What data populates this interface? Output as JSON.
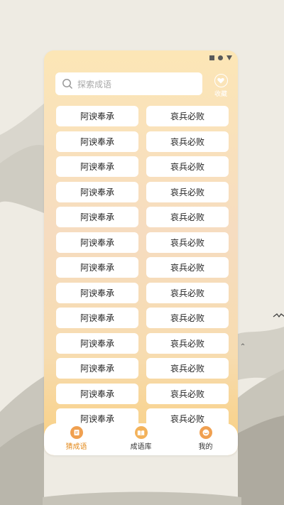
{
  "search": {
    "placeholder": "探索成语",
    "icon": "search-icon"
  },
  "favorite": {
    "label": "收藏",
    "icon": "heart-icon"
  },
  "idiom_rows": [
    {
      "left": "阿谀奉承",
      "right": "哀兵必败"
    },
    {
      "left": "阿谀奉承",
      "right": "哀兵必败"
    },
    {
      "left": "阿谀奉承",
      "right": "哀兵必败"
    },
    {
      "left": "阿谀奉承",
      "right": "哀兵必败"
    },
    {
      "left": "阿谀奉承",
      "right": "哀兵必败"
    },
    {
      "left": "阿谀奉承",
      "right": "哀兵必败"
    },
    {
      "left": "阿谀奉承",
      "right": "哀兵必败"
    },
    {
      "left": "阿谀奉承",
      "right": "哀兵必败"
    },
    {
      "left": "阿谀奉承",
      "right": "哀兵必败"
    },
    {
      "left": "阿谀奉承",
      "right": "哀兵必败"
    },
    {
      "left": "阿谀奉承",
      "right": "哀兵必败"
    },
    {
      "left": "阿谀奉承",
      "right": "哀兵必败"
    },
    {
      "left": "阿谀奉承",
      "right": "哀兵必败"
    }
  ],
  "tabs": [
    {
      "label": "猜成语",
      "icon": "quiz-icon",
      "active": true
    },
    {
      "label": "成语库",
      "icon": "book-icon",
      "active": false
    },
    {
      "label": "我的",
      "icon": "profile-icon",
      "active": false
    }
  ],
  "colors": {
    "accent": "#e38a1c",
    "card_top": "#fce6b6",
    "card_bottom": "#f8cf80"
  }
}
